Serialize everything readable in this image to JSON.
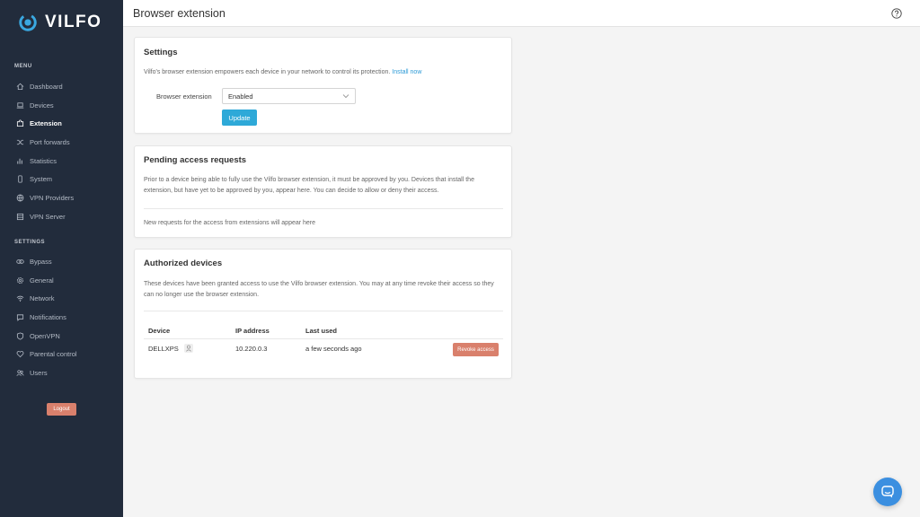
{
  "app": {
    "brand": "VILFO",
    "accent": "#2ea9d8",
    "danger": "#d9806c",
    "sidebar_bg": "#222c3c"
  },
  "sidebar": {
    "menu_label": "MENU",
    "menu_items": [
      {
        "label": "Dashboard",
        "icon": "home-icon"
      },
      {
        "label": "Devices",
        "icon": "laptop-icon"
      },
      {
        "label": "Extension",
        "icon": "puzzle-icon",
        "active": true
      },
      {
        "label": "Port forwards",
        "icon": "shuffle-icon"
      },
      {
        "label": "Statistics",
        "icon": "bar-chart-icon"
      },
      {
        "label": "System",
        "icon": "phone-icon"
      },
      {
        "label": "VPN Providers",
        "icon": "globe-icon"
      },
      {
        "label": "VPN Server",
        "icon": "server-icon"
      }
    ],
    "settings_label": "SETTINGS",
    "settings_items": [
      {
        "label": "Bypass",
        "icon": "link-icon"
      },
      {
        "label": "General",
        "icon": "gear-icon"
      },
      {
        "label": "Network",
        "icon": "wifi-icon"
      },
      {
        "label": "Notifications",
        "icon": "chat-bubble-icon"
      },
      {
        "label": "OpenVPN",
        "icon": "shield-icon"
      },
      {
        "label": "Parental control",
        "icon": "heart-icon"
      },
      {
        "label": "Users",
        "icon": "users-icon"
      }
    ],
    "logout_label": "Logout"
  },
  "header": {
    "title": "Browser extension",
    "help_icon": "help-circle-icon"
  },
  "settings_card": {
    "title": "Settings",
    "description": "Vilfo's browser extension empowers each device in your network to control its protection.",
    "install_link": "Install now",
    "field_label": "Browser extension",
    "select_value": "Enabled",
    "update_label": "Update"
  },
  "pending_card": {
    "title": "Pending access requests",
    "description": "Prior to a device being able to fully use the Vilfo browser extension, it must be approved by you. Devices that install the extension, but have yet to be approved by you, appear here. You can decide to allow or deny their access.",
    "empty_text": "New requests for the access from extensions will appear here"
  },
  "authorized_card": {
    "title": "Authorized devices",
    "description": "These devices have been granted access to use the Vilfo browser extension. You may at any time revoke their access so they can no longer use the browser extension.",
    "columns": [
      "Device",
      "IP address",
      "Last used"
    ],
    "rows": [
      {
        "device": "DELLXPS",
        "ip": "10.220.0.3",
        "last_used": "a few seconds ago",
        "action": "Revoke access"
      }
    ]
  },
  "chat": {
    "icon": "chat-icon"
  }
}
